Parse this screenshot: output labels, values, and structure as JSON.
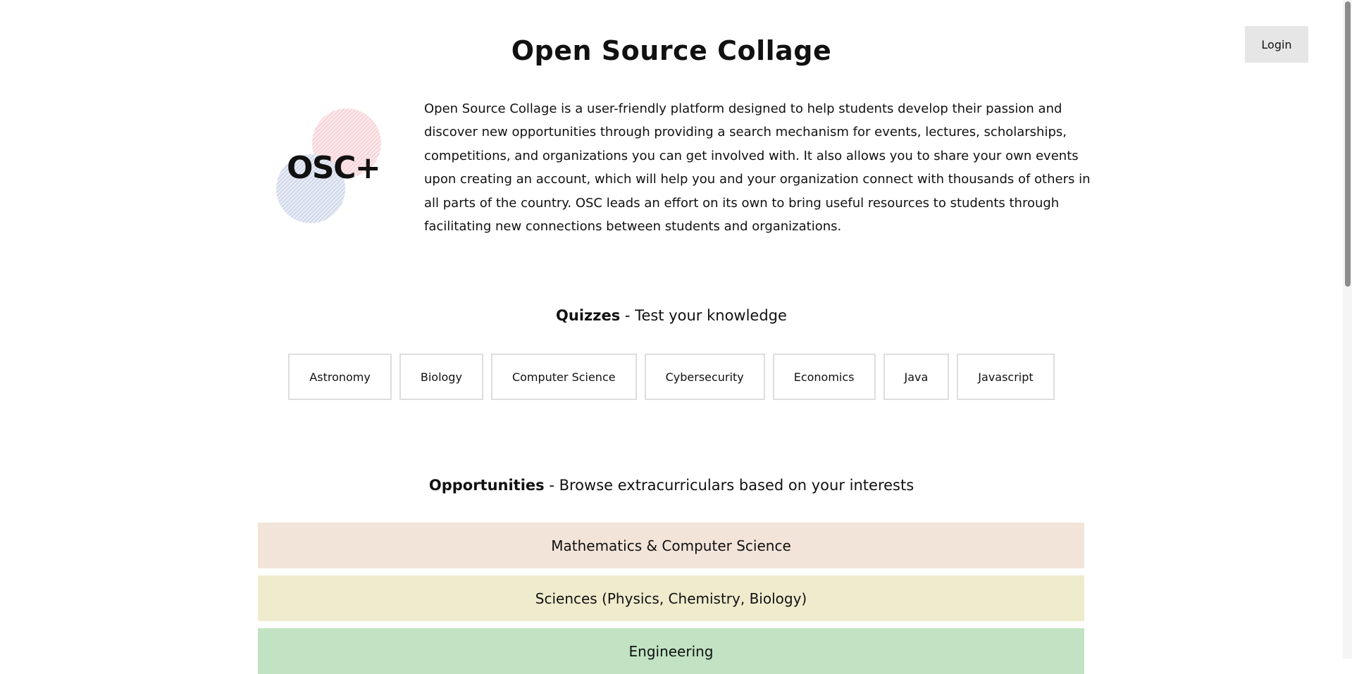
{
  "header": {
    "title": "Open Source Collage",
    "login_label": "Login"
  },
  "logo": {
    "text": "OSC+",
    "colors": {
      "pink": "#f2b8bf",
      "blue": "#b4bedc"
    }
  },
  "intro": {
    "text": "Open Source Collage is a user-friendly platform designed to help students develop their passion and discover new opportunities through providing a search mechanism for events, lectures, scholarships, competitions, and organizations you can get involved with. It also allows you to share your own events upon creating an account, which will help you and your organization connect with thousands of others in all parts of the country. OSC leads an effort on its own to bring useful resources to students through facilitating new connections between students and organizations."
  },
  "quizzes": {
    "heading_bold": "Quizzes",
    "heading_rest": " - Test your knowledge",
    "items": [
      "Astronomy",
      "Biology",
      "Computer Science",
      "Cybersecurity",
      "Economics",
      "Java",
      "Javascript"
    ]
  },
  "opportunities": {
    "heading_bold": "Opportunities",
    "heading_rest": " - Browse extracurriculars based on your interests",
    "categories": [
      {
        "label": "Mathematics & Computer Science",
        "color": "#f3e4d9"
      },
      {
        "label": "Sciences (Physics, Chemistry, Biology)",
        "color": "#efecce"
      },
      {
        "label": "Engineering",
        "color": "#c1e3c3"
      }
    ]
  }
}
